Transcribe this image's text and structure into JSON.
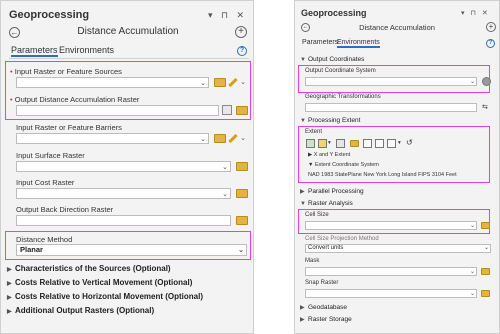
{
  "left": {
    "title": "Geoprocessing",
    "header_icons": "▾ ⊓ ✕",
    "tool_title": "Distance Accumulation",
    "tabs": [
      "Parameters",
      "Environments"
    ],
    "help": "?",
    "params": [
      {
        "label": "Input Raster or Feature Sources",
        "required": true
      },
      {
        "label": "Output Distance Accumulation Raster",
        "required": true
      },
      {
        "label": "Input Raster or Feature Barriers",
        "required": false
      },
      {
        "label": "Input Surface Raster",
        "required": false
      },
      {
        "label": "Input Cost Raster",
        "required": false
      },
      {
        "label": "Output Back Direction Raster",
        "required": false
      }
    ],
    "distance_method": {
      "label": "Distance Method",
      "value": "Planar"
    },
    "sections": [
      "Characteristics of the Sources (Optional)",
      "Costs Relative to Vertical Movement (Optional)",
      "Costs Relative to Horizontal Movement (Optional)",
      "Additional Output Rasters (Optional)"
    ],
    "highlight_color": "#e63ee6"
  },
  "right": {
    "title": "Geoprocessing",
    "header_icons": "▾ ⊓ ✕",
    "tool_title": "Distance Accumulation",
    "tabs": [
      "Parameters",
      "Environments"
    ],
    "help": "?",
    "output_coordinates": {
      "section": "Output Coordinates",
      "ocs_label": "Output Coordinate System",
      "gt_label": "Geographic Transformations"
    },
    "processing_extent": {
      "section": "Processing Extent",
      "extent_label": "Extent",
      "xy_extent": "X and Y Extent",
      "ecs": "Extent Coordinate System",
      "ecs_value": "NAD 1983 StatePlane New York Long Island FIPS 3104 Feet"
    },
    "parallel_processing": "Parallel Processing",
    "raster_analysis": {
      "section": "Raster Analysis",
      "cell_size_label": "Cell Size",
      "projection_label": "Cell Size Projection Method",
      "projection_value": "Convert units",
      "mask_label": "Mask",
      "snap_label": "Snap Raster"
    },
    "geodatabase": "Geodatabase",
    "raster_storage": "Raster Storage"
  }
}
